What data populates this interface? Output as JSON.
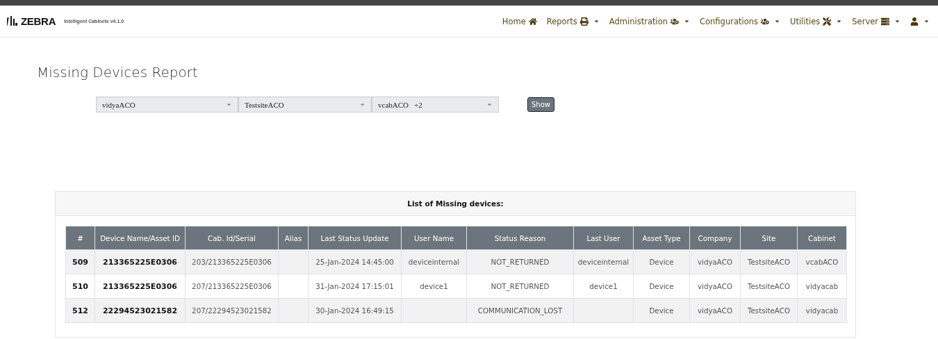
{
  "brand": {
    "logo": "ZEBRA",
    "product": "Intelligent Cabinets v4.1.0"
  },
  "nav": [
    {
      "label": "Home",
      "has_menu": false
    },
    {
      "label": "Reports",
      "has_menu": true
    },
    {
      "label": "Administration",
      "has_menu": true
    },
    {
      "label": "Configurations",
      "has_menu": true
    },
    {
      "label": "Utilities",
      "has_menu": true
    },
    {
      "label": "Server",
      "has_menu": true
    },
    {
      "has_menu": true
    }
  ],
  "page_title": "Missing Devices Report",
  "filters": [
    {
      "value": "vidyaACO"
    },
    {
      "value": "TestsiteACO"
    },
    {
      "value": "vcabACO",
      "extra": "+2"
    }
  ],
  "show_button": "Show",
  "table": {
    "caption": "List of Missing devices:",
    "columns": [
      "#",
      "Device Name/Asset ID",
      "Cab. Id/Serial",
      "Alias",
      "Last Status Update",
      "User Name",
      "Status Reason",
      "Last User",
      "Asset Type",
      "Company",
      "Site",
      "Cabinet"
    ],
    "rows": [
      [
        "509",
        "213365225E0306",
        "203/213365225E0306",
        "",
        "25-Jan-2024 14:45:00",
        "deviceinternal",
        "NOT_RETURNED",
        "deviceinternal",
        "Device",
        "vidyaACO",
        "TestsiteACO",
        "vcabACO"
      ],
      [
        "510",
        "213365225E0306",
        "207/213365225E0306",
        "",
        "31-Jan-2024 17:15:01",
        "device1",
        "NOT_RETURNED",
        "device1",
        "Device",
        "vidyaACO",
        "TestsiteACO",
        "vidyacab"
      ],
      [
        "512",
        "22294523021582",
        "207/22294523021582",
        "",
        "30-Jan-2024 16:49:15",
        "",
        "COMMUNICATION_LOST",
        "",
        "Device",
        "vidyaACO",
        "TestsiteACO",
        "vidyacab"
      ]
    ]
  }
}
